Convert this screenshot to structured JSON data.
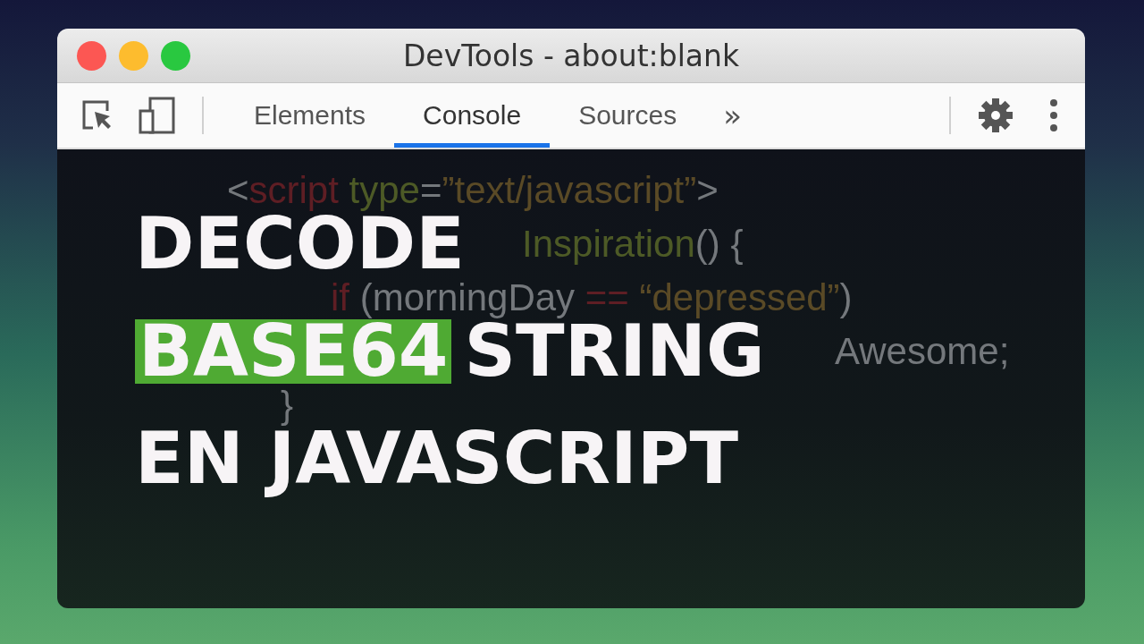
{
  "window": {
    "title": "DevTools - about:blank"
  },
  "tabs": [
    {
      "label": "Elements",
      "selected": false
    },
    {
      "label": "Console",
      "selected": true
    },
    {
      "label": "Sources",
      "selected": false
    }
  ],
  "more_tabs": "»",
  "code_lines": [
    {
      "tokens": [
        {
          "kind": "punct",
          "text": "<"
        },
        {
          "kind": "tag",
          "text": "script"
        },
        {
          "kind": "attr",
          "text": " type"
        },
        {
          "kind": "punct",
          "text": "="
        },
        {
          "kind": "string",
          "text": "”text/javascript”"
        },
        {
          "kind": "punct",
          "text": ">"
        }
      ]
    },
    {
      "tokens": [
        {
          "kind": "attr",
          "text": "Inspiration"
        },
        {
          "kind": "punct",
          "text": "() {"
        }
      ]
    },
    {
      "tokens": [
        {
          "kind": "tag",
          "text": "if "
        },
        {
          "kind": "punct",
          "text": "(morningDay "
        },
        {
          "kind": "tag",
          "text": "=="
        },
        {
          "kind": "string",
          "text": " “depressed”"
        },
        {
          "kind": "punct",
          "text": ")"
        }
      ]
    },
    {
      "tokens": [
        {
          "kind": "punct",
          "text": "Awesome;"
        }
      ]
    },
    {
      "tokens": [
        {
          "kind": "punct",
          "text": "}"
        }
      ]
    }
  ],
  "headline": [
    [
      {
        "text": "DECODE",
        "highlighted": false
      }
    ],
    [
      {
        "text": "BASE64",
        "highlighted": true
      },
      {
        "text": "STRING",
        "highlighted": false
      }
    ],
    [
      {
        "text": "EN JAVASCRIPT",
        "highlighted": false
      }
    ]
  ]
}
